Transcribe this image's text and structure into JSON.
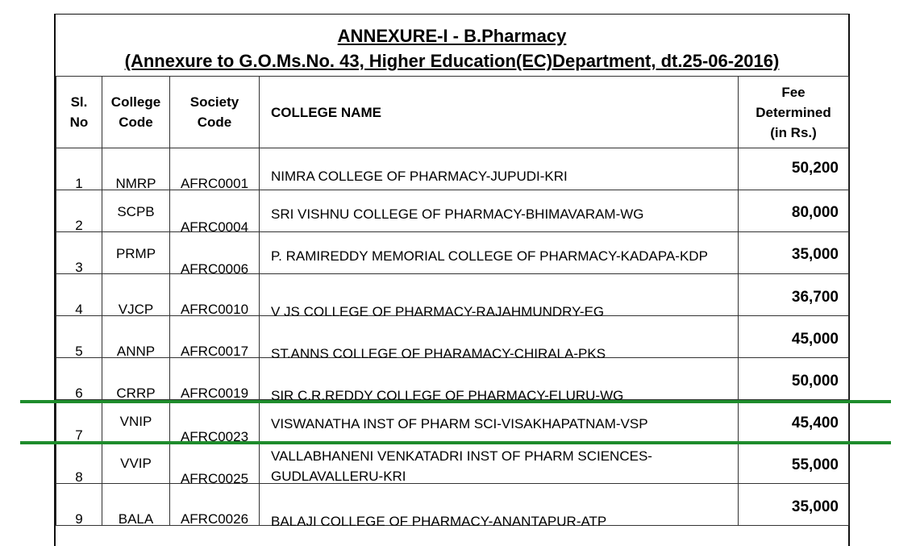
{
  "title": {
    "line1": "ANNEXURE-I - B.Pharmacy",
    "line2": "(Annexure to G.O.Ms.No. 43, Higher Education(EC)Department, dt.25-06-2016)"
  },
  "headers": {
    "sl_no": "Sl. No",
    "college_code": "College Code",
    "society_code": "Society Code",
    "college_name": "COLLEGE NAME",
    "fee": "Fee Determined (in Rs.)"
  },
  "rows": [
    {
      "sl": "1",
      "code": "NMRP",
      "society": "AFRC0001",
      "name": "NIMRA COLLEGE OF PHARMACY-JUPUDI-KRI",
      "fee": "50,200"
    },
    {
      "sl": "2",
      "code": "SCPB",
      "society": "AFRC0004",
      "name": "SRI VISHNU COLLEGE OF PHARMACY-BHIMAVARAM-WG",
      "fee": "80,000"
    },
    {
      "sl": "3",
      "code": "PRMP",
      "society": "AFRC0006",
      "name": "P. RAMIREDDY MEMORIAL COLLEGE OF PHARMACY-KADAPA-KDP",
      "fee": "35,000"
    },
    {
      "sl": "4",
      "code": "VJCP",
      "society": "AFRC0010",
      "name": "V JS COLLEGE OF PHARMACY-RAJAHMUNDRY-EG",
      "fee": "36,700"
    },
    {
      "sl": "5",
      "code": "ANNP",
      "society": "AFRC0017",
      "name": "ST.ANNS COLLEGE OF PHARAMACY-CHIRALA-PKS",
      "fee": "45,000"
    },
    {
      "sl": "6",
      "code": "CRRP",
      "society": "AFRC0019",
      "name": "SIR C.R.REDDY COLLEGE OF PHARMACY-ELURU-WG",
      "fee": "50,000"
    },
    {
      "sl": "7",
      "code": "VNIP",
      "society": "AFRC0023",
      "name": "VISWANATHA INST OF PHARM SCI-VISAKHAPATNAM-VSP",
      "fee": "45,400"
    },
    {
      "sl": "8",
      "code": "VVIP",
      "society": "AFRC0025",
      "name": "VALLABHANENI VENKATADRI INST OF PHARM SCIENCES-GUDLAVALLERU-KRI",
      "fee": "55,000"
    },
    {
      "sl": "9",
      "code": "BALA",
      "society": "AFRC0026",
      "name": "BALAJI COLLEGE OF PHARMACY-ANANTAPUR-ATP",
      "fee": "35,000"
    }
  ],
  "highlight": {
    "row": "7",
    "color": "#1e8c2c"
  }
}
